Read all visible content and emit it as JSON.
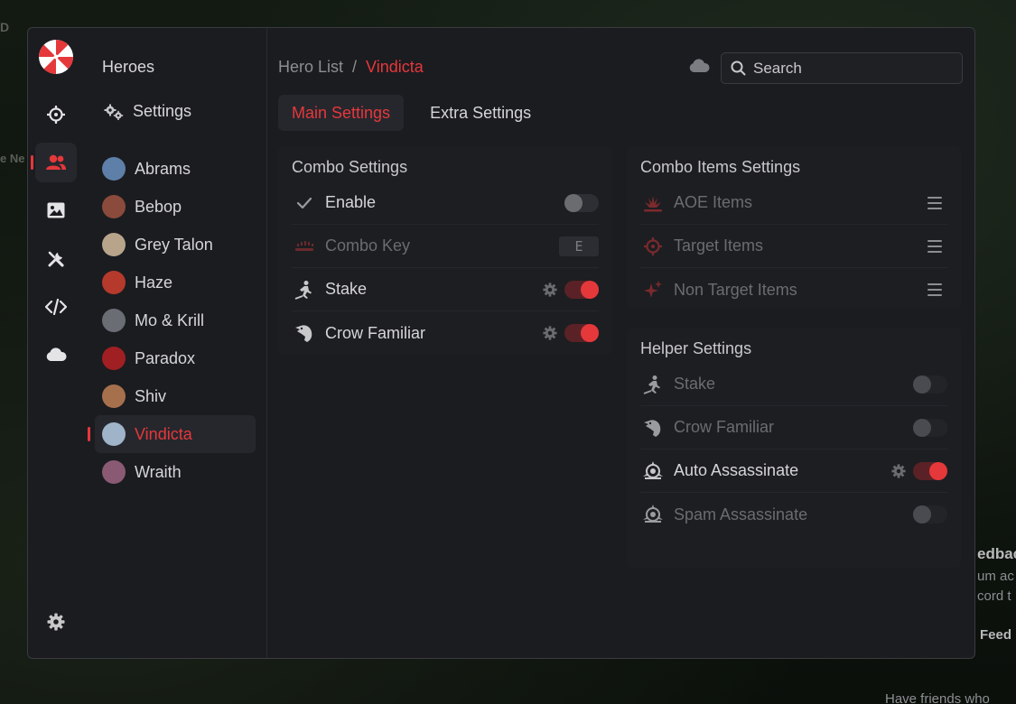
{
  "background": {
    "text_fragments": [
      "D",
      "e Ne",
      "edbac",
      "um ac",
      "cord t",
      "Feed",
      "Have friends who"
    ]
  },
  "colors": {
    "accent": "#e5383b",
    "window_bg": "#1b1c20",
    "panel_bg": "#1d1e22"
  },
  "rail": {
    "items": [
      {
        "icon": "crosshair-icon"
      },
      {
        "icon": "users-icon",
        "active": true
      },
      {
        "icon": "image-icon"
      },
      {
        "icon": "tools-icon"
      },
      {
        "icon": "code-icon"
      },
      {
        "icon": "cloud-icon"
      }
    ],
    "bottom_icon": "gear-icon"
  },
  "heroes_panel": {
    "title": "Heroes",
    "settings_label": "Settings",
    "heroes": [
      {
        "name": "Abrams",
        "color": "#5d7fa8"
      },
      {
        "name": "Bebop",
        "color": "#8a4a3c"
      },
      {
        "name": "Grey Talon",
        "color": "#b7a48a"
      },
      {
        "name": "Haze",
        "color": "#b53a2c"
      },
      {
        "name": "Mo & Krill",
        "color": "#6a6d74"
      },
      {
        "name": "Paradox",
        "color": "#a01f22"
      },
      {
        "name": "Shiv",
        "color": "#a7704d"
      },
      {
        "name": "Vindicta",
        "color": "#9fb4c8",
        "active": true
      },
      {
        "name": "Wraith",
        "color": "#8a5a74"
      }
    ]
  },
  "header": {
    "breadcrumb_root": "Hero List",
    "breadcrumb_sep": "/",
    "breadcrumb_current": "Vindicta",
    "search_placeholder": "Search"
  },
  "tabs": [
    {
      "label": "Main Settings",
      "active": true
    },
    {
      "label": "Extra Settings",
      "active": false
    }
  ],
  "combo_settings": {
    "title": "Combo Settings",
    "rows": [
      {
        "label": "Enable",
        "icon": "check-icon",
        "control": "toggle",
        "on": false
      },
      {
        "label": "Combo Key",
        "icon": "keyboard-icon",
        "control": "key",
        "key": "E",
        "dim": true
      },
      {
        "label": "Stake",
        "icon": "stake-icon",
        "control": "toggle",
        "on": true,
        "gear": true
      },
      {
        "label": "Crow Familiar",
        "icon": "crow-icon",
        "control": "toggle",
        "on": true,
        "gear": true
      }
    ]
  },
  "combo_items_settings": {
    "title": "Combo Items Settings",
    "rows": [
      {
        "label": "AOE Items",
        "icon": "explosion-icon"
      },
      {
        "label": "Target Items",
        "icon": "target-icon"
      },
      {
        "label": "Non Target Items",
        "icon": "sparkle-icon"
      }
    ]
  },
  "helper_settings": {
    "title": "Helper Settings",
    "rows": [
      {
        "label": "Stake",
        "icon": "stake-icon",
        "on": false,
        "dim": true
      },
      {
        "label": "Crow Familiar",
        "icon": "crow-icon",
        "on": false,
        "dim": true
      },
      {
        "label": "Auto Assassinate",
        "icon": "assassinate-icon",
        "on": true,
        "gear": true
      },
      {
        "label": "Spam Assassinate",
        "icon": "assassinate-icon",
        "on": false,
        "dim": true
      }
    ]
  }
}
